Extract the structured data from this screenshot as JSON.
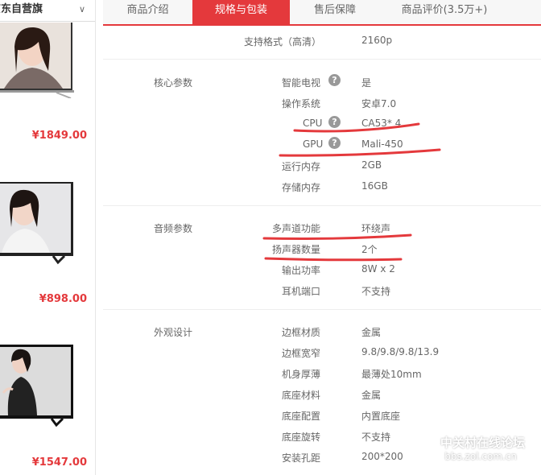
{
  "left": {
    "shop_header": "京东自营旗",
    "products": [
      {
        "price": "¥1849.00"
      },
      {
        "price": "¥898.00"
      },
      {
        "price": "¥1547.00"
      }
    ]
  },
  "tabs": [
    {
      "label": "商品介绍"
    },
    {
      "label": "规格与包装"
    },
    {
      "label": "售后保障"
    },
    {
      "label": "商品评价(3.5万+)"
    }
  ],
  "top_row": {
    "key": "支持格式（高清）",
    "value": "2160p"
  },
  "sections": [
    {
      "title": "核心参数",
      "rows": [
        {
          "key": "智能电视",
          "value": "是"
        },
        {
          "key": "操作系统",
          "value": "安卓7.0"
        },
        {
          "key": "CPU",
          "value": "CA53* 4"
        },
        {
          "key": "GPU",
          "value": "Mali-450"
        },
        {
          "key": "运行内存",
          "value": "2GB"
        },
        {
          "key": "存储内存",
          "value": "16GB"
        }
      ]
    },
    {
      "title": "音频参数",
      "rows": [
        {
          "key": "多声道功能",
          "value": "环绕声"
        },
        {
          "key": "扬声器数量",
          "value": "2个"
        },
        {
          "key": "输出功率",
          "value": "8W x 2"
        },
        {
          "key": "耳机端口",
          "value": "不支持"
        }
      ]
    },
    {
      "title": "外观设计",
      "rows": [
        {
          "key": "边框材质",
          "value": "金属"
        },
        {
          "key": "边框宽窄",
          "value": "9.8/9.8/9.8/13.9"
        },
        {
          "key": "机身厚薄",
          "value": "最薄处10mm"
        },
        {
          "key": "底座材料",
          "value": "金属"
        },
        {
          "key": "底座配置",
          "value": "内置底座"
        },
        {
          "key": "底座旋转",
          "value": "不支持"
        },
        {
          "key": "安装孔距",
          "value": "200*200"
        }
      ]
    }
  ],
  "watermark": {
    "title": "中关村在线论坛",
    "url": "bbs.zol.com.cn"
  },
  "colors": {
    "accent": "#e4393c",
    "annotation": "#e4393c"
  }
}
